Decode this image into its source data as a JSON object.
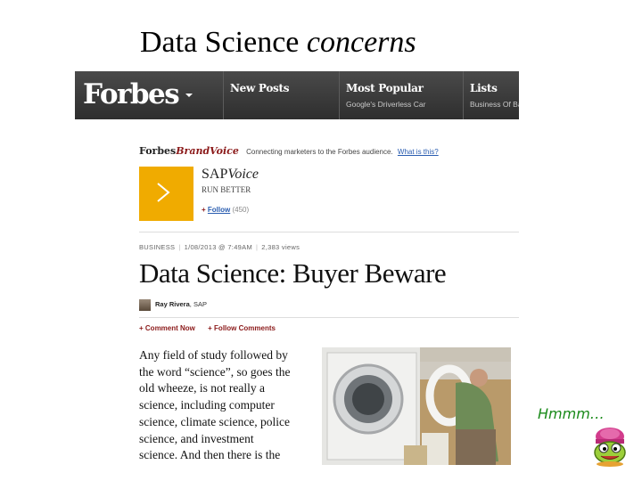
{
  "slide": {
    "title_plain": "Data Science ",
    "title_italic": "concerns",
    "aside": "Hmmm…"
  },
  "forbes": {
    "logo": "Forbes",
    "nav": [
      {
        "label": "New Posts",
        "sub": ""
      },
      {
        "label": "Most Popular",
        "sub": "Google's Driverless Car"
      },
      {
        "label": "Lists",
        "sub": "Business Of Ba"
      }
    ]
  },
  "brandvoice": {
    "forbes": "Forbes",
    "brand": "BrandVoice",
    "tagline": "Connecting marketers to the Forbes audience.",
    "what": "What is this?"
  },
  "sap": {
    "name": "SAP",
    "voice": "Voice",
    "tag": "RUN BETTER",
    "follow_plus": "+",
    "follow_label": "Follow",
    "follow_count": "(450)"
  },
  "article": {
    "section": "BUSINESS",
    "date": "1/08/2013 @ 7:49AM",
    "views": "2,383 views",
    "headline": "Data Science: Buyer Beware",
    "author_name": "Ray Rivera",
    "author_org": ", SAP",
    "comment_plus": "+",
    "comment_now": "Comment Now",
    "follow_plus": "+",
    "follow_comments": "Follow Comments",
    "body_lines": [
      "Any field of study followed by",
      "the word “science”, so goes the",
      "old wheeze, is not really a",
      "science, including computer",
      "science, climate science, police",
      "science, and investment",
      "science. And then there is the"
    ]
  },
  "colors": {
    "sap_yellow": "#f0ab00",
    "forbes_bar": "#3a3a3a",
    "link_blue": "#2a5db0",
    "brand_red": "#8b1a1a",
    "aside_green": "#1a8a1a"
  },
  "icons": [
    "chevron-right-icon",
    "caret-down-icon",
    "author-avatar",
    "washing-machine-photo",
    "cartoon-mascot"
  ]
}
